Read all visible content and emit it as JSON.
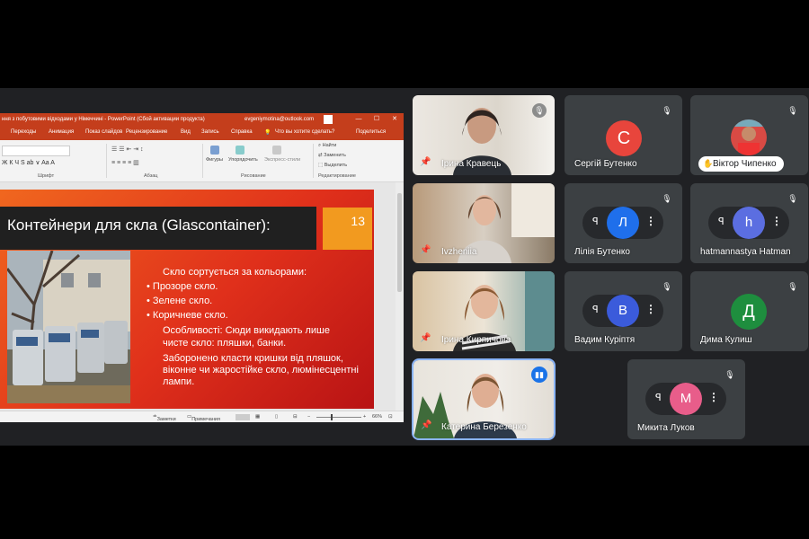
{
  "ppt": {
    "title": "ння з побутовими відходами у Німеччині  -  PowerPoint (Сбой активации продукта)",
    "account": "evgeniymotina@outlook.com",
    "window_min": "—",
    "window_max": "☐",
    "window_close": "✕",
    "tabs": [
      "Переходы",
      "Анимация",
      "Показ слайдов",
      "Рецензирование",
      "Вид",
      "Запись",
      "Справка"
    ],
    "tell_me": "Что вы хотите сделать?",
    "share": "Поделиться",
    "ribbon": {
      "font_group": "Шрифт",
      "paragraph_group": "Абзац",
      "drawing_group": "Рисование",
      "editing_group": "Редактирование",
      "shapes": "Фигуры",
      "arrange": "Упорядочить",
      "quick_styles": "Экспресс-стили",
      "find": "Найти",
      "replace": "Заменить",
      "select": "Выделить"
    },
    "status": {
      "notes": "Заметки",
      "comments": "Примечания",
      "zoom": "66%"
    }
  },
  "slide": {
    "title": "Контейнери для скла (Glascontainer):",
    "number": "13",
    "lines": [
      "Скло сортується за кольорами:",
      "• Прозоре скло.",
      "• Зелене скло.",
      "• Коричневе скло.",
      "Особливості:    Сюди викидають лише",
      "чисте скло: пляшки, банки.",
      "Заборонено класти кришки від пляшок,",
      "віконне чи жаростійке скло, люмінесцентні",
      "лампи."
    ]
  },
  "participants": [
    {
      "name": "Ірина Кравець",
      "type": "video"
    },
    {
      "name": "Сергій Бутенко",
      "type": "avatar",
      "initial": "С",
      "color": "#e8453c"
    },
    {
      "name": "Віктор Чипенко",
      "type": "photo"
    },
    {
      "name": "Ivzheniia",
      "type": "video"
    },
    {
      "name": "Лілія Бутенко",
      "type": "pic",
      "initial": "Л",
      "color": "#1f6feb"
    },
    {
      "name": "hatmannastya Hatman",
      "type": "pic",
      "initial": "h",
      "color": "#5b6ee1"
    },
    {
      "name": "Ірина Кирпичова",
      "type": "video"
    },
    {
      "name": "Вадим Куріптя",
      "type": "pic",
      "initial": "В",
      "color": "#3b5bdb"
    },
    {
      "name": "Дима Кулиш",
      "type": "avatar",
      "initial": "Д",
      "color": "#1e8e3e"
    },
    {
      "name": "Катерина Березенко",
      "type": "video",
      "speaking": true
    },
    {
      "name": "Микита Луков",
      "type": "pic",
      "initial": "M",
      "color": "#e85d8a"
    }
  ],
  "icons": {
    "mic_off": "mic-off-icon",
    "pin": "pin-icon",
    "more": "more-options-icon",
    "speaking": "audio-level-icon"
  }
}
